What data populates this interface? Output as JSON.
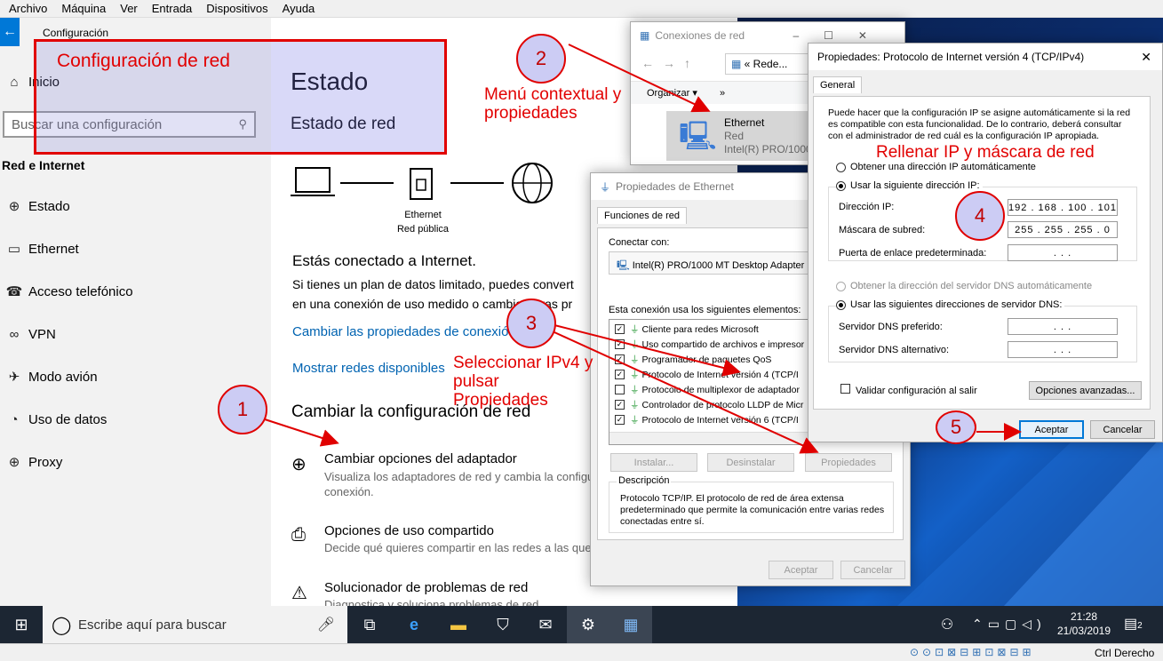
{
  "vm_menu": [
    "Archivo",
    "Máquina",
    "Ver",
    "Entrada",
    "Dispositivos",
    "Ayuda"
  ],
  "settings": {
    "window_title": "Configuración",
    "home": "Inicio",
    "search_placeholder": "Buscar una configuración",
    "section": "Red e Internet",
    "nav": [
      {
        "icon": "globe-icon",
        "label": "Estado"
      },
      {
        "icon": "ethernet-icon",
        "label": "Ethernet"
      },
      {
        "icon": "dialup-icon",
        "label": "Acceso telefónico"
      },
      {
        "icon": "vpn-icon",
        "label": "VPN"
      },
      {
        "icon": "airplane-icon",
        "label": "Modo avión"
      },
      {
        "icon": "data-usage-icon",
        "label": "Uso de datos"
      },
      {
        "icon": "proxy-icon",
        "label": "Proxy"
      }
    ],
    "page_title": "Estado",
    "subtitle": "Estado de red",
    "diagram": {
      "device_name": "Ethernet",
      "network_type": "Red pública"
    },
    "connected_heading": "Estás conectado a Internet.",
    "connected_body_1": "Si tienes un plan de datos limitado, puedes convert",
    "connected_body_2": "en una conexión de uso medido o cambiar otras pr",
    "link_change_props": "Cambiar las propiedades de conexión",
    "link_show_networks": "Mostrar redes disponibles",
    "change_heading": "Cambiar la configuración de red",
    "options": [
      {
        "icon": "adapter-icon",
        "title": "Cambiar opciones del adaptador",
        "desc1": "Visualiza los adaptadores de red y cambia la configu",
        "desc2": "conexión."
      },
      {
        "icon": "sharing-icon",
        "title": "Opciones de uso compartido",
        "desc1": "Decide qué quieres compartir en las redes a las que",
        "desc2": ""
      },
      {
        "icon": "troubleshoot-icon",
        "title": "Solucionador de problemas de red",
        "desc1": "Diagnostica y soluciona problemas de red",
        "desc2": ""
      }
    ]
  },
  "annotations": {
    "config_red": "Configuración de  red",
    "step1": "1",
    "step2": "2",
    "step2_text": "Menú contextual y\npropiedades",
    "step3": "3",
    "step3_text": "Seleccionar IPv4 y\npulsar\nPropiedades",
    "step4": "4",
    "step4_text": "Rellenar IP y máscara de red",
    "step5": "5"
  },
  "net_connections": {
    "title": "Conexiones de red",
    "address": "« Rede...",
    "organize": "Organizar",
    "more": "»",
    "item": {
      "name": "Ethernet",
      "status": "Red",
      "adapter": "Intel(R) PRO/1000"
    }
  },
  "eth_props": {
    "title": "Propiedades de Ethernet",
    "tab": "Funciones de red",
    "connect_with": "Conectar con:",
    "adapter": "Intel(R) PRO/1000 MT Desktop Adapter",
    "uses_label": "Esta conexión usa los siguientes elementos:",
    "items": [
      {
        "checked": true,
        "label": "Cliente para redes Microsoft"
      },
      {
        "checked": true,
        "label": "Uso compartido de archivos e impresor"
      },
      {
        "checked": true,
        "label": "Programador de paquetes QoS"
      },
      {
        "checked": true,
        "label": "Protocolo de Internet versión 4 (TCP/I"
      },
      {
        "checked": false,
        "label": "Protocolo de multiplexor de adaptador"
      },
      {
        "checked": true,
        "label": "Controlador de protocolo LLDP de Micr"
      },
      {
        "checked": true,
        "label": "Protocolo de Internet versión 6 (TCP/I"
      }
    ],
    "install": "Instalar...",
    "uninstall": "Desinstalar",
    "properties": "Propiedades",
    "description_label": "Descripción",
    "description": "Protocolo TCP/IP. El protocolo de red de área extensa predeterminado que permite la comunicación entre varias redes conectadas entre sí.",
    "ok": "Aceptar",
    "cancel": "Cancelar"
  },
  "ipv4": {
    "title": "Propiedades: Protocolo de Internet versión 4 (TCP/IPv4)",
    "tab": "General",
    "intro": "Puede hacer que la configuración IP se asigne automáticamente si la red es compatible con esta funcionalidad. De lo contrario, deberá consultar con el administrador de red cuál es la configuración IP apropiada.",
    "auto_ip": "Obtener una dirección IP automáticamente",
    "manual_ip": "Usar la siguiente dirección IP:",
    "ip_label": "Dirección IP:",
    "ip_value": "192 . 168 . 100 . 101",
    "mask_label": "Máscara de subred:",
    "mask_value": "255 . 255 . 255 .  0",
    "gateway_label": "Puerta de enlace predeterminada:",
    "gateway_value": ".      .      .",
    "auto_dns": "Obtener la dirección del servidor DNS automáticamente",
    "manual_dns": "Usar las siguientes direcciones de servidor DNS:",
    "dns1_label": "Servidor DNS preferido:",
    "dns1_value": ".      .      .",
    "dns2_label": "Servidor DNS alternativo:",
    "dns2_value": ".      .      .",
    "validate": "Validar configuración al salir",
    "advanced": "Opciones avanzadas...",
    "ok": "Aceptar",
    "cancel": "Cancelar"
  },
  "taskbar": {
    "search_placeholder": "Escribe aquí para buscar",
    "time": "21:28",
    "date": "21/03/2019",
    "notif_count": "2"
  },
  "vm_status": {
    "host_key": "Ctrl Derecho"
  },
  "colors": {
    "accent": "#0078d7",
    "annotation_red": "#e00000",
    "link": "#0063b1"
  }
}
